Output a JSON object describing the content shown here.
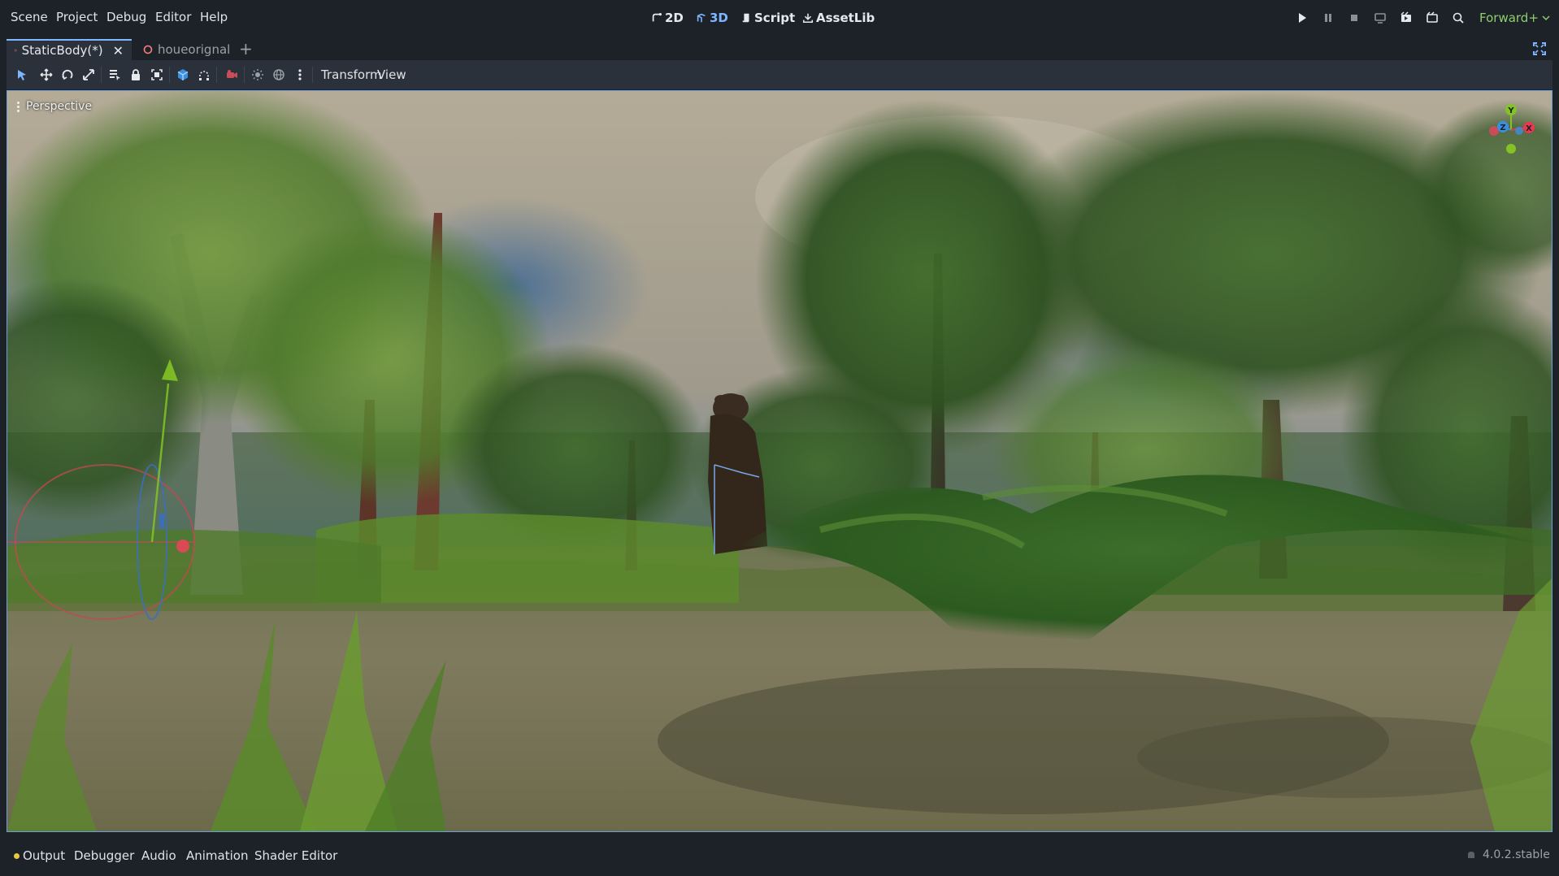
{
  "menu": {
    "items": [
      "Scene",
      "Project",
      "Debug",
      "Editor",
      "Help"
    ]
  },
  "workspaces": {
    "items": [
      {
        "label": "2D",
        "icon": "2d-icon"
      },
      {
        "label": "3D",
        "icon": "3d-icon"
      },
      {
        "label": "Script",
        "icon": "script-icon"
      },
      {
        "label": "AssetLib",
        "icon": "assetlib-icon"
      }
    ],
    "active": "3D"
  },
  "run_controls": [
    "play-icon",
    "pause-icon",
    "stop-icon",
    "remote-debug-icon",
    "play-scene-icon",
    "play-custom-scene-icon",
    "movie-maker-icon"
  ],
  "renderer": {
    "label": "Forward+",
    "color": "#8ecf6c"
  },
  "tabs": [
    {
      "label": "StaticBody(*)",
      "active": true,
      "icon": "scene-icon"
    },
    {
      "label": "houeorignal",
      "active": false,
      "icon": "unsaved-circle-icon"
    }
  ],
  "toolbar": {
    "tools": [
      "select-icon",
      "move-icon",
      "rotate-icon",
      "scale-icon",
      "list-select-icon",
      "lock-icon",
      "group-icon",
      "local-space-icon",
      "snap-icon",
      "camera-override-icon",
      "sun-icon",
      "environment-icon",
      "more-icon"
    ],
    "transform_label": "Transform",
    "view_label": "View"
  },
  "viewport": {
    "label": "Perspective",
    "gizmo_axes": {
      "x": "X",
      "y": "Y",
      "z": "Z"
    },
    "colors": {
      "x": "#e8394f",
      "y": "#84c325",
      "z": "#3a8fe0"
    }
  },
  "bottom_panel": {
    "tabs": [
      "Output",
      "Debugger",
      "Audio",
      "Animation",
      "Shader Editor"
    ],
    "version": "4.0.2.stable"
  },
  "accent": "#7eb6ff"
}
